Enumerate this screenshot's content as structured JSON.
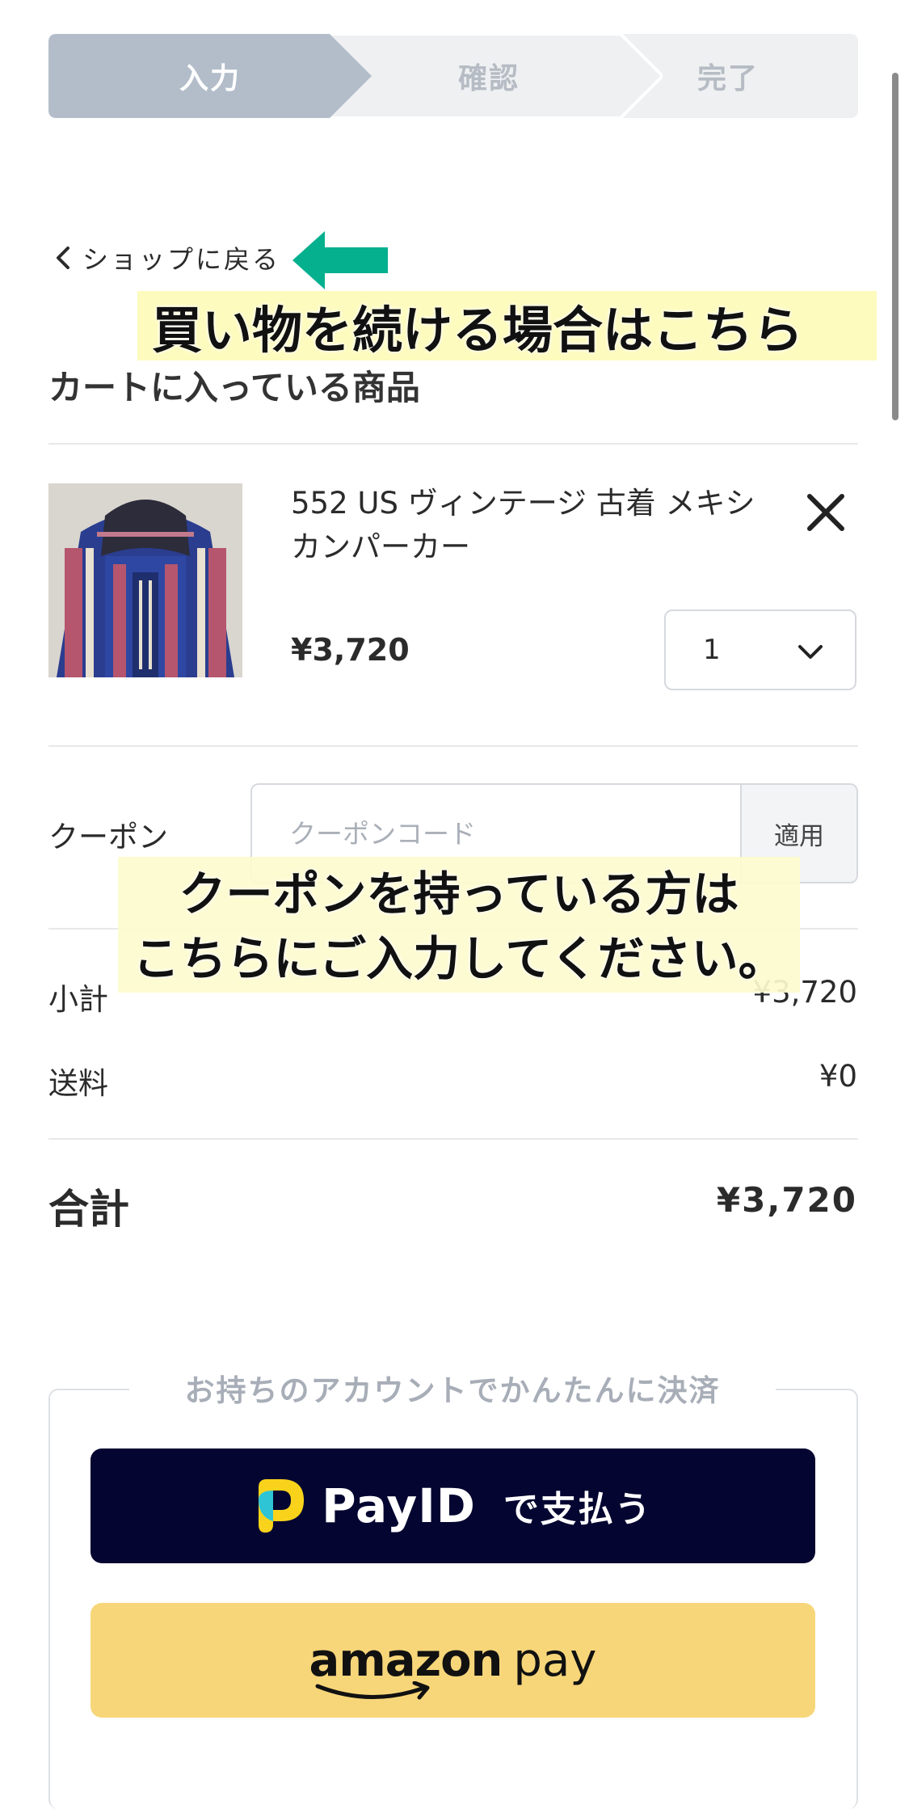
{
  "steps": [
    {
      "label": "入力",
      "active": true
    },
    {
      "label": "確認",
      "active": false
    },
    {
      "label": "完了",
      "active": false
    }
  ],
  "colors": {
    "step_active": "#b3bdca",
    "step_inactive": "#eef0f2",
    "annotation_arrow": "#05b08e",
    "annotation_highlight": "#fdfbbd",
    "payid_bg": "#040530",
    "amazon_bg": "#f7d67a"
  },
  "back_link": {
    "label": "ショップに戻る",
    "icon": "chevron-left-icon"
  },
  "annotations": {
    "back_note": "買い物を続ける場合はこちら",
    "coupon_note_line1": "クーポンを持っている方は",
    "coupon_note_line2": "こちらにご入力してください。"
  },
  "cart": {
    "title": "カートに入っている商品",
    "item": {
      "name": "552 US ヴィンテージ 古着 メキシカンパーカー",
      "price": "¥3,720",
      "quantity": "1",
      "remove_icon": "close-icon",
      "thumbnail": "striped-hoodie-photo"
    }
  },
  "coupon": {
    "label": "クーポン",
    "placeholder": "クーポンコード",
    "apply_label": "適用"
  },
  "summary": {
    "subtotal_label": "小計",
    "subtotal_value": "¥3,720",
    "shipping_label": "送料",
    "shipping_value": "¥0",
    "total_label": "合計",
    "total_value": "¥3,720"
  },
  "payment": {
    "caption": "お持ちのアカウントでかんたんに決済",
    "payid_brand": "PayID",
    "payid_suffix": "で支払う",
    "amazon_brand": "amazon",
    "amazon_pay": "pay"
  }
}
